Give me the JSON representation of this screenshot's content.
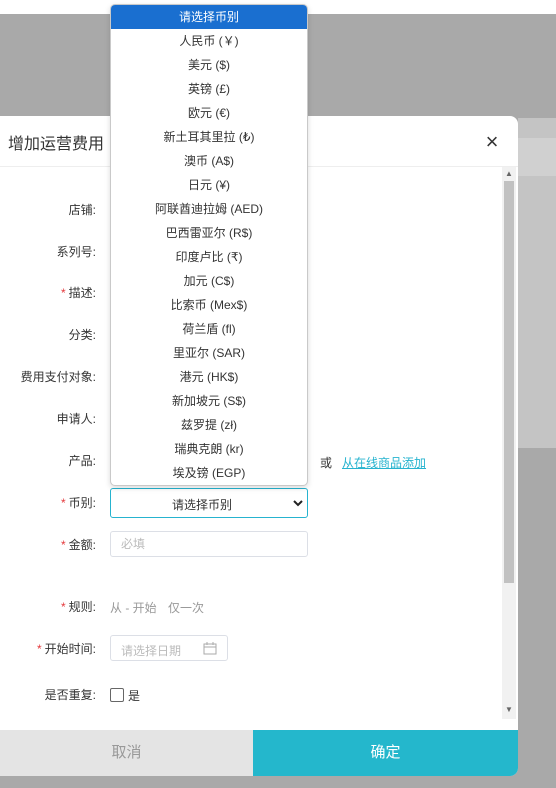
{
  "modal": {
    "title": "增加运营费用",
    "close_glyph": "×"
  },
  "form": {
    "labels": {
      "store": "店铺:",
      "series": "系列号:",
      "description": "描述:",
      "category": "分类:",
      "payee": "费用支付对象:",
      "applicant": "申请人:",
      "product": "产品:",
      "currency": "币别:",
      "amount": "金额:",
      "rule": "规则:",
      "start_time": "开始时间:",
      "repeat": "是否重复:"
    },
    "required_mark": "*",
    "product_or": "或",
    "product_link": "从在线商品添加",
    "currency_selected": "请选择币别",
    "amount_placeholder": "必填",
    "rule_from": "从 - 开始",
    "rule_once": "仅一次",
    "date_placeholder": "请选择日期",
    "repeat_label": "是"
  },
  "currency_options": [
    "请选择币别",
    "人民币 (￥)",
    "美元 ($)",
    "英镑 (£)",
    "欧元 (€)",
    "新土耳其里拉 (₺)",
    "澳币 (A$)",
    "日元 (¥)",
    "阿联酋迪拉姆 (AED)",
    "巴西雷亚尔 (R$)",
    "印度卢比 (₹)",
    "加元 (C$)",
    "比索币 (Mex$)",
    "荷兰盾 (fl)",
    "里亚尔 (SAR)",
    "港元 (HK$)",
    "新加坡元 (S$)",
    "兹罗提 (zł)",
    "瑞典克朗 (kr)",
    "埃及镑 (EGP)"
  ],
  "footer": {
    "cancel": "取消",
    "confirm": "确定"
  },
  "colors": {
    "accent": "#24b7cc",
    "selected_option": "#1a6fd0",
    "required": "#e4393c",
    "link": "#26b3cf"
  },
  "icons": {
    "close": "close-icon",
    "chevron": "chevron-down-icon",
    "calendar": "calendar-icon",
    "scroll_up": "scroll-up-arrow-icon",
    "scroll_down": "scroll-down-arrow-icon"
  }
}
